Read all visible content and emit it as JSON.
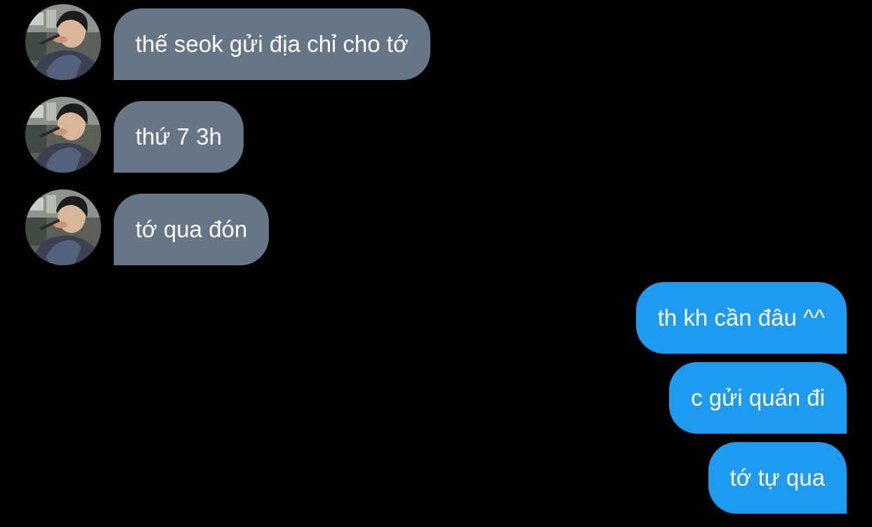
{
  "conversation": {
    "incoming": [
      {
        "text": "thế seok gửi địa chỉ cho tớ"
      },
      {
        "text": "thứ 7 3h"
      },
      {
        "text": "tớ qua đón"
      }
    ],
    "outgoing": [
      {
        "text": "th kh cần đâu ^^"
      },
      {
        "text": "c gửi quán đi"
      },
      {
        "text": "tớ tự qua"
      }
    ]
  },
  "colors": {
    "background": "#000000",
    "incoming_bubble": "#667687",
    "outgoing_bubble": "#1d9bf0",
    "text": "#ffffff"
  }
}
